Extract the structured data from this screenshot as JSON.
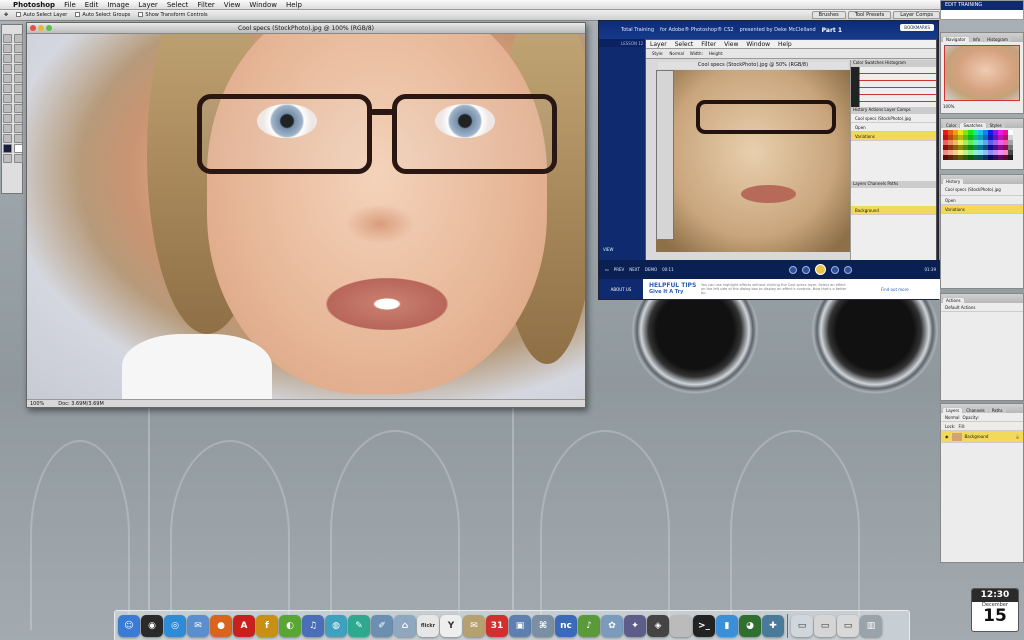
{
  "menubar": {
    "app": "Photoshop",
    "items": [
      "File",
      "Edit",
      "Image",
      "Layer",
      "Select",
      "Filter",
      "View",
      "Window",
      "Help"
    ]
  },
  "options": {
    "items": [
      "Auto Select Layer",
      "Auto Select Groups",
      "Show Transform Controls"
    ],
    "palette_tabs": [
      "Brushes",
      "Tool Presets",
      "Layer Comps"
    ]
  },
  "edit_label": "EDIT TRAINING",
  "doc": {
    "title": "Cool specs (StockPhoto).jpg @ 100% (RGB/8)",
    "zoom": "100%",
    "docsize": "Doc: 3.69M/3.69M"
  },
  "video": {
    "brand": "Total Training",
    "product": "for Adobe® Photoshop® CS2",
    "presenter": "presented by Deke McClelland",
    "part": "Part 1",
    "bookmarks": "BOOKMARKS",
    "lesson": "LESSON 12 MAKING THE MOST OF HISTORY",
    "topic": "TOPIC 02 USING UNDO",
    "inner_menu": [
      "Layer",
      "Select",
      "Filter",
      "View",
      "Window",
      "Help"
    ],
    "inner_title": "Cool specs (StockPhoto).jpg @ 50% (RGB/8)",
    "inner_panels": [
      "Color",
      "Swatches",
      "Styles",
      "Histogram",
      "History",
      "Actions",
      "Layer Comps",
      "Layers",
      "Channels",
      "Paths"
    ],
    "history": [
      "Cool specs (StockPhoto).jpg",
      "Open",
      "Variations"
    ],
    "layer": "Background",
    "inner_options": [
      "Style:",
      "Normal",
      "Width:",
      "Height:"
    ],
    "view": "VIEW",
    "time": "00:11",
    "duration": "01:39",
    "ctrl_labels": [
      "PREV",
      "NEXT",
      "DEMO",
      "PLAY",
      "PAUSE"
    ],
    "tips_title": "HELPFUL TIPS",
    "tips_sub": "Give It A Try",
    "tips_text": "You can use highlight effects without clicking the Cool specs layer. Select an effect on the left side of the dialog box to display an effect's controls. Now that's a better tip",
    "find_out_more": "Find out more",
    "about": "ABOUT US"
  },
  "right": {
    "navigator_tabs": [
      "Navigator",
      "Info",
      "Histogram"
    ],
    "zoom": "100%",
    "swatches_tabs": [
      "Color",
      "Swatches",
      "Styles"
    ],
    "history_tabs": [
      "History"
    ],
    "history": [
      "Cool specs (StockPhoto).jpg",
      "Open",
      "Variations"
    ],
    "actions_tabs": [
      "Actions"
    ],
    "actions": [
      "Default Actions"
    ],
    "layers_tabs": [
      "Layers",
      "Channels",
      "Paths"
    ],
    "layers_opts": [
      "Normal",
      "Opacity:",
      "Lock:",
      "Fill:"
    ],
    "layer": "Background"
  },
  "clock": {
    "time": "12:30",
    "ampm": "PM",
    "month": "December",
    "day": "15"
  },
  "dock": [
    {
      "name": "finder-icon",
      "glyph": "☺",
      "color": "#3a7bd5"
    },
    {
      "name": "dashboard-icon",
      "glyph": "◉",
      "color": "#2a2a2a"
    },
    {
      "name": "safari-icon",
      "glyph": "◎",
      "color": "#2e8bd8"
    },
    {
      "name": "mail-icon",
      "glyph": "✉",
      "color": "#5b8ecf"
    },
    {
      "name": "firefox-icon",
      "glyph": "●",
      "color": "#d9641e"
    },
    {
      "name": "adobe-reader-icon",
      "glyph": "A",
      "color": "#c8201c"
    },
    {
      "name": "flash-icon",
      "glyph": "f",
      "color": "#c79014"
    },
    {
      "name": "dreamweaver-icon",
      "glyph": "◐",
      "color": "#5aa635"
    },
    {
      "name": "itunes-icon",
      "glyph": "♫",
      "color": "#4a6fb8"
    },
    {
      "name": "ichat-icon",
      "glyph": "◍",
      "color": "#3fa0c0"
    },
    {
      "name": "quill-icon",
      "glyph": "✎",
      "color": "#2fa890"
    },
    {
      "name": "pages-icon",
      "glyph": "✐",
      "color": "#6a8fb0"
    },
    {
      "name": "home-icon",
      "glyph": "⌂",
      "color": "#8fa8c0"
    },
    {
      "name": "flickr-icon",
      "glyph": "flickr",
      "color": "#e6e6e6"
    },
    {
      "name": "yahoo-icon",
      "glyph": "Y",
      "color": "#eeeeee"
    },
    {
      "name": "stamps-icon",
      "glyph": "✉",
      "color": "#b6a070"
    },
    {
      "name": "ical-icon",
      "glyph": "31",
      "color": "#d03030"
    },
    {
      "name": "preview-icon",
      "glyph": "▣",
      "color": "#5e7fb0"
    },
    {
      "name": "network-icon",
      "glyph": "⌘",
      "color": "#7a8fa3"
    },
    {
      "name": "nc-icon",
      "glyph": "nc",
      "color": "#3b6bb8"
    },
    {
      "name": "garageband-icon",
      "glyph": "♪",
      "color": "#5a9a3a"
    },
    {
      "name": "iphoto-icon",
      "glyph": "✿",
      "color": "#7a9bbd"
    },
    {
      "name": "imovie-icon",
      "glyph": "✦",
      "color": "#5d5d8a"
    },
    {
      "name": "idvd-icon",
      "glyph": "◈",
      "color": "#444"
    },
    {
      "name": "apple-icon",
      "glyph": "",
      "color": "#bbb"
    },
    {
      "name": "terminal-icon",
      "glyph": ">_",
      "color": "#222"
    },
    {
      "name": "utility-icon",
      "glyph": "▮",
      "color": "#3b8fd8"
    },
    {
      "name": "globe-icon",
      "glyph": "◕",
      "color": "#2f6f2f"
    },
    {
      "name": "sync-icon",
      "glyph": "✚",
      "color": "#4a7a9a"
    },
    {
      "name": "window-thumb-1-icon",
      "glyph": "▭",
      "color": "#cfd6dc"
    },
    {
      "name": "window-thumb-2-icon",
      "glyph": "▭",
      "color": "#d5d5d5"
    },
    {
      "name": "window-thumb-3-icon",
      "glyph": "▭",
      "color": "#d8d8d8"
    },
    {
      "name": "trash-icon",
      "glyph": "▥",
      "color": "#9aa3aa"
    }
  ]
}
